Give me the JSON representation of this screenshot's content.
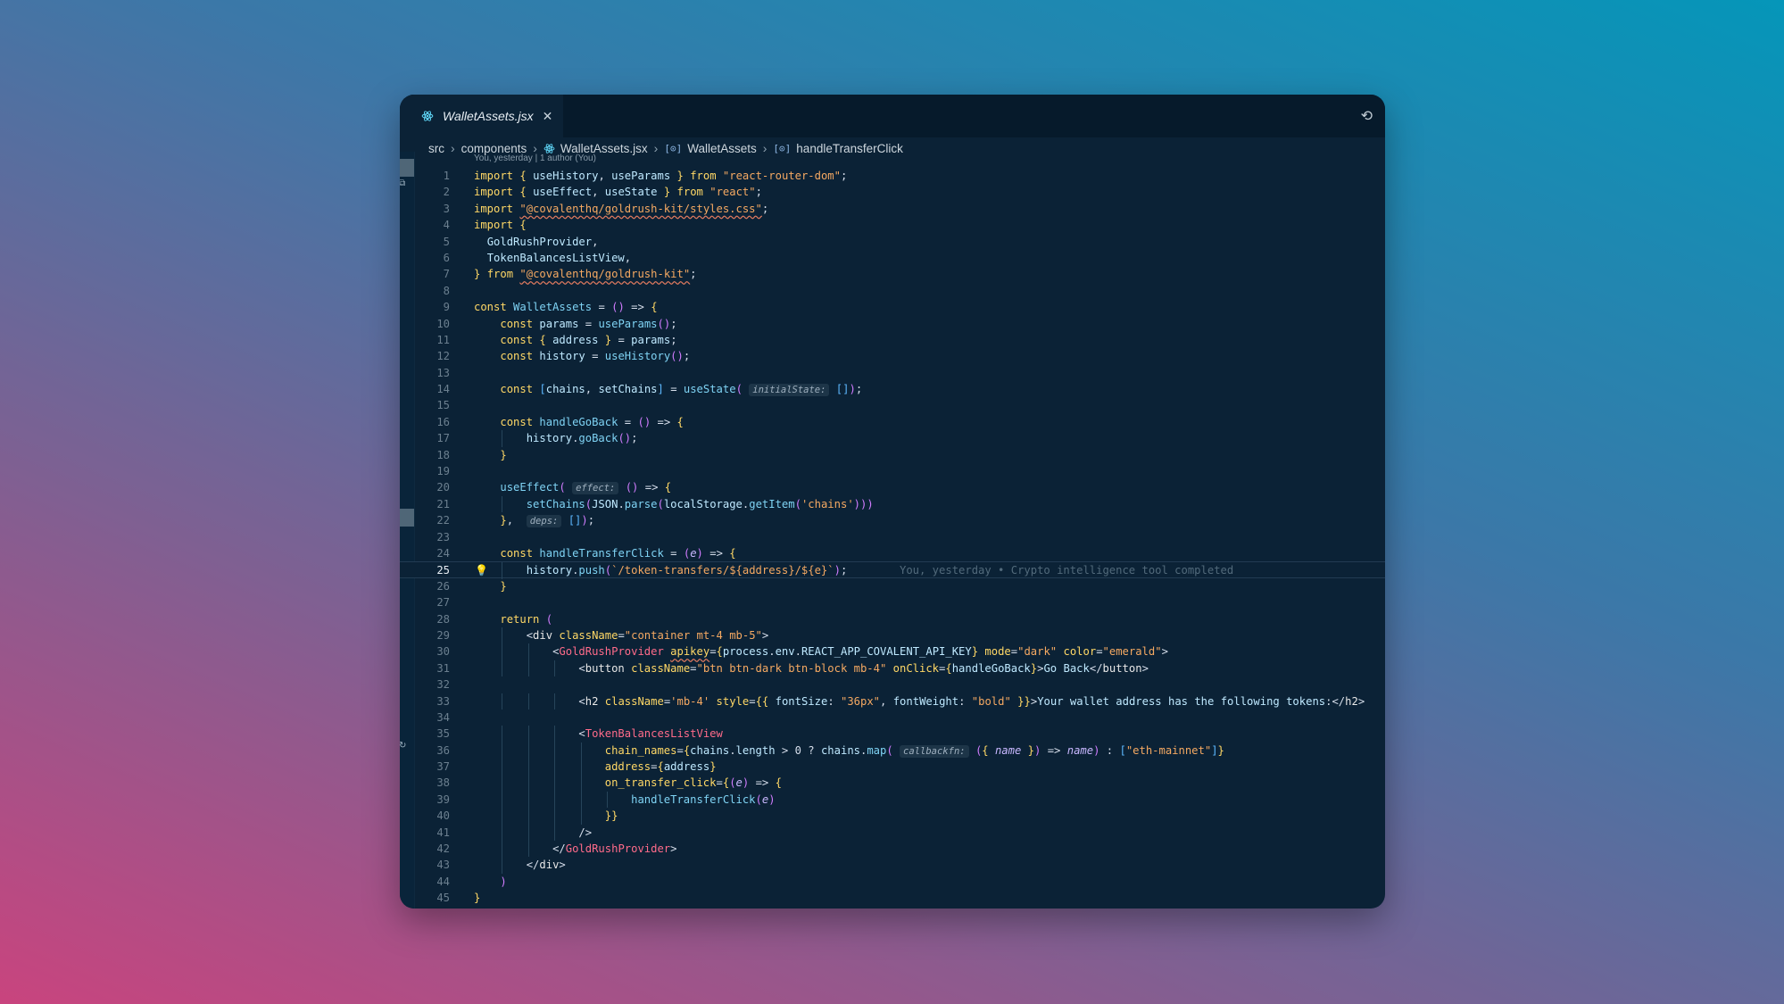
{
  "tab": {
    "filename": "WalletAssets.jsx"
  },
  "breadcrumb": [
    "src",
    "components",
    "WalletAssets.jsx",
    "WalletAssets",
    "handleTransferClick"
  ],
  "blame_header": "You, yesterday | 1 author (You)",
  "inline_blame": "You, yesterday • Crypto intelligence tool completed",
  "code": {
    "current_line": 25,
    "lines": [
      "import { useHistory, useParams } from \"react-router-dom\";",
      "import { useEffect, useState } from \"react\";",
      "import \"@covalenthq/goldrush-kit/styles.css\";",
      "import {",
      "  GoldRushProvider,",
      "  TokenBalancesListView,",
      "} from \"@covalenthq/goldrush-kit\";",
      "",
      "const WalletAssets = () => {",
      "    const params = useParams();",
      "    const { address } = params;",
      "    const history = useHistory();",
      "",
      "    const [chains, setChains] = useState( initialState: []);",
      "",
      "    const handleGoBack = () => {",
      "        history.goBack();",
      "    }",
      "",
      "    useEffect( effect: () => {",
      "        setChains(JSON.parse(localStorage.getItem('chains')))",
      "    },  deps: []);",
      "",
      "    const handleTransferClick = (e) => {",
      "        history.push(`/token-transfers/${address}/${e}`);",
      "    }",
      "",
      "    return (",
      "        <div className=\"container mt-4 mb-5\">",
      "            <GoldRushProvider apikey={process.env.REACT_APP_COVALENT_API_KEY} mode=\"dark\" color=\"emerald\">",
      "                <button className=\"btn btn-dark btn-block mb-4\" onClick={handleGoBack}>Go Back</button>",
      "",
      "                <h2 className='mb-4' style={{ fontSize: \"36px\", fontWeight: \"bold\" }}>Your wallet address has the following tokens:</h2>",
      "",
      "                <TokenBalancesListView",
      "                    chain_names={chains.length > 0 ? chains.map( callbackfn: ({ name }) => name) : [\"eth-mainnet\"]}",
      "                    address={address}",
      "                    on_transfer_click={(e) => {",
      "                        handleTransferClick(e)",
      "                    }}",
      "                />",
      "            </GoldRushProvider>",
      "        </div>",
      "    )",
      "}"
    ]
  },
  "colors": {
    "window_bg": "#0b2236",
    "tabbar_bg": "#061a2b",
    "keyword": "#ffd866",
    "string": "#f5a962",
    "function": "#7fd3f4",
    "jsx_tag": "#ff6b8a"
  },
  "icons": [
    "react-icon",
    "close-icon",
    "gitlens-icon",
    "symbol-icon",
    "lightbulb-icon"
  ]
}
